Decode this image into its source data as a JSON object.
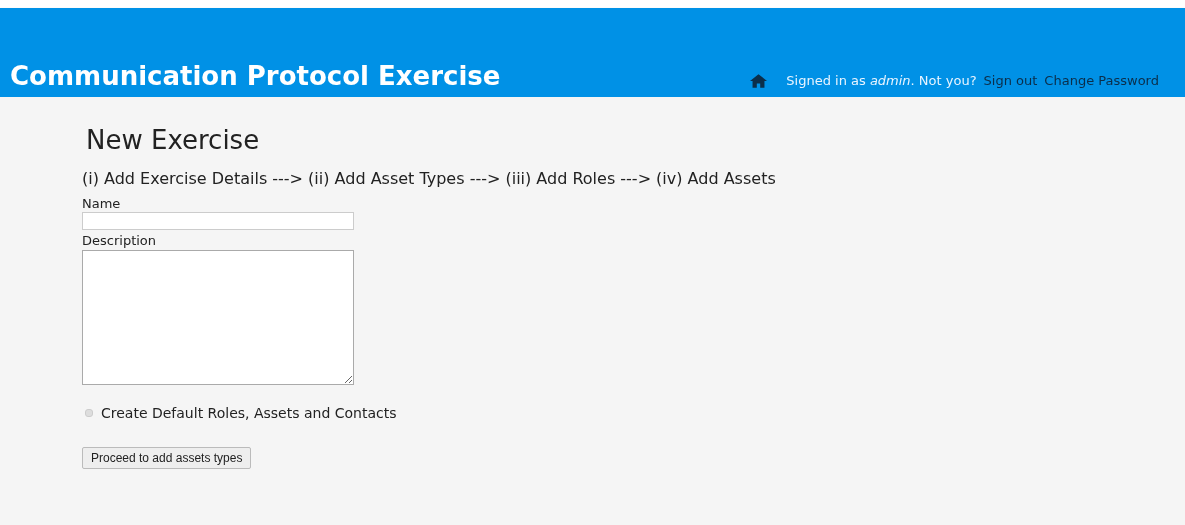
{
  "header": {
    "title": "Communication Protocol Exercise",
    "signed_in": "Signed in as *admin*. Not you?",
    "links": [
      "Sign out",
      "Change Password"
    ]
  },
  "page": {
    "heading": "New Exercise",
    "steps": "(i) Add Exercise Details ---> (ii) Add Asset Types ---> (iii) Add Roles ---> (iv) Add Assets"
  },
  "form": {
    "name_label": "Name",
    "description_label": "Description",
    "checkbox": {
      "label": "Create Default Roles, Assets and Contacts",
      "checked": false
    },
    "submit": "Proceed to add assets types"
  }
}
